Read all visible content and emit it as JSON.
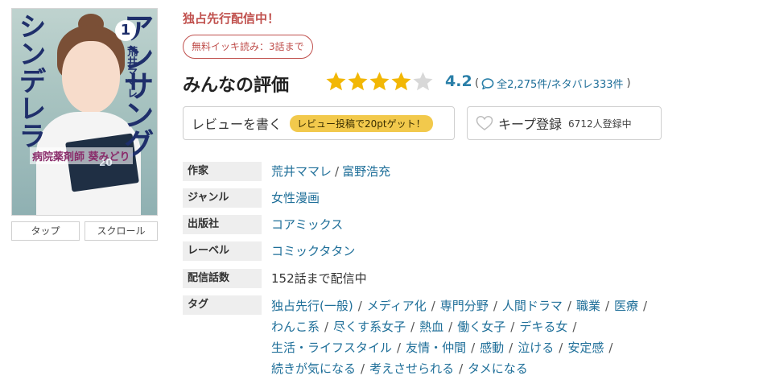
{
  "cover": {
    "title_right": "アンサング",
    "title_left": "シンデレラ",
    "volume": "1",
    "author": "荒井ママレ",
    "subtitle": "病院薬剤師 葵みどり",
    "book_number": "20"
  },
  "viewer": {
    "tap_label": "タップ",
    "scroll_label": "スクロール"
  },
  "exclusive_label": "独占先行配信中！",
  "free_badge": "無料イッキ読み：3話まで",
  "rating": {
    "title": "みんなの評価",
    "score": "4.2",
    "score_value": 4.2,
    "stars_max": 5,
    "open_paren": "(",
    "counts": "全2,275件/ネタバレ333件",
    "close_paren": ")"
  },
  "review_button": {
    "label": "レビューを書く",
    "promo": "レビュー投稿で20ptゲット！"
  },
  "keep_button": {
    "label": "キープ登録",
    "count": "6712人登録中"
  },
  "info": {
    "author": {
      "key": "作家",
      "values": [
        "荒井ママレ",
        "富野浩充"
      ],
      "sep": "/"
    },
    "genre": {
      "key": "ジャンル",
      "value": "女性漫画"
    },
    "publisher": {
      "key": "出版社",
      "value": "コアミックス"
    },
    "label": {
      "key": "レーベル",
      "value": "コミックタタン"
    },
    "episodes": {
      "key": "配信話数",
      "value": "152話まで配信中"
    },
    "tags": {
      "key": "タグ",
      "sep": "/",
      "lines": [
        [
          "独占先行(一般)",
          "メディア化",
          "専門分野",
          "人間ドラマ",
          "職業",
          "医療"
        ],
        [
          "わんこ系",
          "尽くす系女子",
          "熱血",
          "働く女子",
          "デキる女"
        ],
        [
          "生活・ライフスタイル",
          "友情・仲間",
          "感動",
          "泣ける",
          "安定感"
        ],
        [
          "続きが気になる",
          "考えさせられる",
          "タメになる"
        ]
      ]
    }
  },
  "colors": {
    "accent_red": "#c0504d",
    "star_gold": "#f2b705",
    "star_empty": "#d8d8d8",
    "score_blue": "#2a7fa8",
    "link_blue": "#1f6f99",
    "promo_yellow": "#f2c94c"
  },
  "icons": {
    "review_bubble": "speech-bubble-icon",
    "keep_heart": "heart-icon"
  }
}
